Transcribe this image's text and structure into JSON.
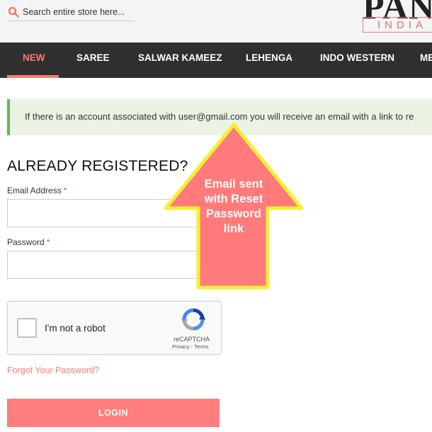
{
  "search": {
    "placeholder": "Search entire store here..."
  },
  "logo": {
    "main": "PAN",
    "sub": "INDIA"
  },
  "nav": {
    "items": [
      {
        "label": "NEW"
      },
      {
        "label": "SAREE"
      },
      {
        "label": "SALWAR KAMEEZ"
      },
      {
        "label": "LEHENGA"
      },
      {
        "label": "INDO WESTERN"
      },
      {
        "label": "ME"
      }
    ],
    "active_color": "#ff7a6e",
    "background": "#2f2f2f"
  },
  "notice": {
    "text": "If there is an account associated with user@gmail.com you will receive an email with a link to re"
  },
  "form": {
    "title": "ALREADY REGISTERED?",
    "email_label": "Email Address",
    "password_label": "Password",
    "required_mark": "*",
    "forgot_link": "Forgot Your Password?",
    "login_button": "LOGIN"
  },
  "captcha": {
    "label": "I'm not a robot",
    "brand": "reCAPTCHA",
    "links": "Privacy - Terms"
  },
  "annotation": {
    "lines": [
      "Email sent",
      "with Reset",
      "Password",
      "link"
    ],
    "fill": "#ff7b7b",
    "stroke": "#f5f032"
  },
  "colors": {
    "accent": "#ff7a6e",
    "login_button": "#ff7d7d",
    "notice_bg": "#ebf4e4",
    "notice_border": "#6bb25b"
  }
}
